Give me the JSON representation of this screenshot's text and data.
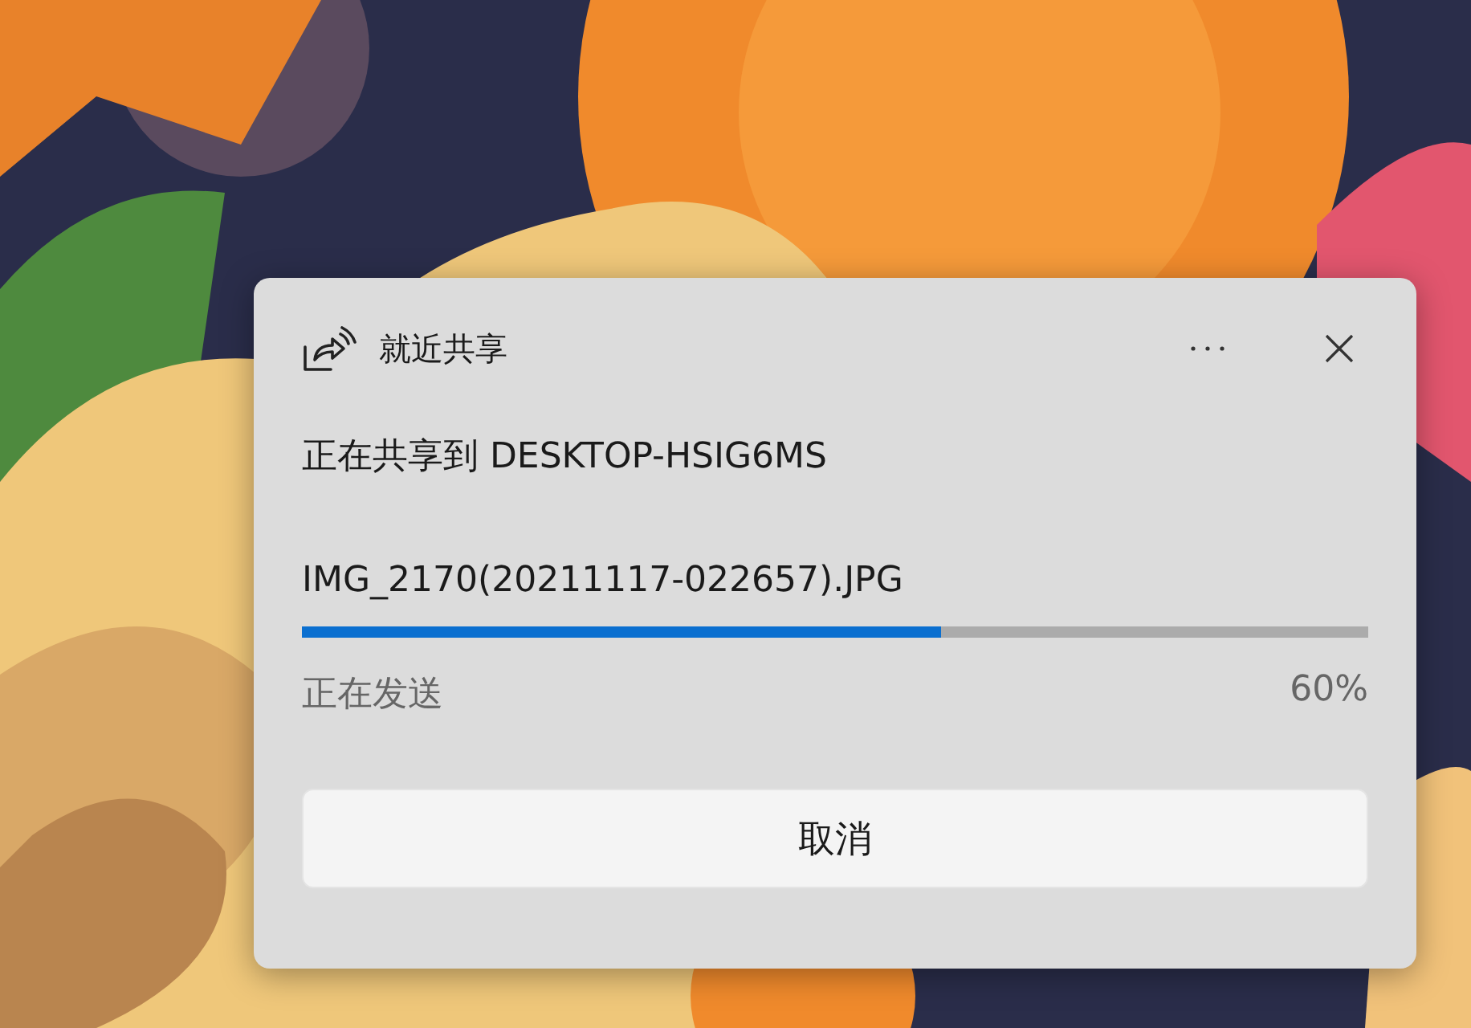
{
  "dialog": {
    "title": "就近共享",
    "message": "正在共享到 DESKTOP-HSIG6MS",
    "file_name": "IMG_2170(20211117-022657).JPG",
    "progress": {
      "level": 0.6,
      "status": "正在发送",
      "percent": "60%"
    },
    "buttons": [
      {
        "label": "取消"
      }
    ]
  }
}
